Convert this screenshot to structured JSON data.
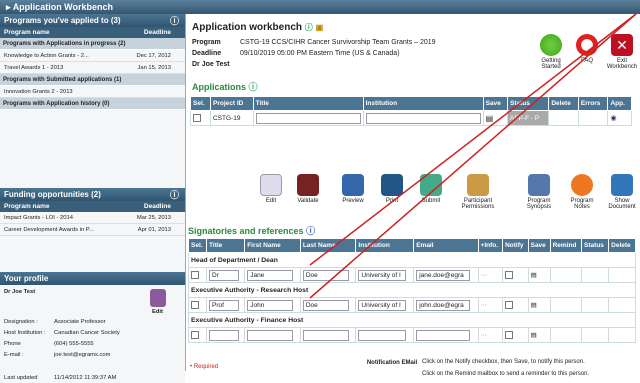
{
  "window": {
    "title": "Application Workbench"
  },
  "left": {
    "applied": {
      "title": "Programs you've applied to (3)",
      "col_name": "Program name",
      "col_deadline": "Deadline",
      "groups": [
        {
          "label": "Programs with Applications in progress (2)",
          "rows": [
            {
              "name": "Knowledge to Action Grants - 2...",
              "deadline": "Dec 17, 2012"
            },
            {
              "name": "Travel Awards 1 - 2013",
              "deadline": "Jan 15, 2013"
            }
          ]
        },
        {
          "label": "Programs with Submitted applications (1)",
          "rows": [
            {
              "name": "Innovation Grants 2 - 2013",
              "deadline": ""
            }
          ]
        },
        {
          "label": "Programs with Application history (0)",
          "rows": []
        }
      ]
    },
    "funding": {
      "title": "Funding opportunities (2)",
      "col_name": "Program name",
      "col_deadline": "Deadline",
      "rows": [
        {
          "name": "Impact Grants - LOI - 2014",
          "deadline": "Mar 25, 2013"
        },
        {
          "name": "Career Development Awards in P...",
          "deadline": "Apr 01, 2013"
        }
      ]
    },
    "profile": {
      "title": "Your profile",
      "name": "Dr Joe Test",
      "edit": "Edit",
      "fields": [
        {
          "label": "Designation :",
          "value": "Associate Professor"
        },
        {
          "label": "Host Institution :",
          "value": "Canadian Cancer Society"
        },
        {
          "label": "Phone",
          "value": "(604) 555-5555"
        },
        {
          "label": "E-mail :",
          "value": "joe.test@egrams.com"
        },
        {
          "label": "Last updated",
          "value": "11/14/2012 11:39:37 AM"
        }
      ]
    }
  },
  "header": {
    "title": "Application workbench",
    "program_label": "Program",
    "program_value": "CSTG-19 CCS/CIHR Cancer Survivorship Team Grants – 2019",
    "deadline_label": "Deadline",
    "deadline_value": "09/10/2019 05:00 PM Eastern Time (US & Canada)",
    "user": "Dr Joe Test",
    "buttons": {
      "getting_started": "Getting Started",
      "faq": "FAQ",
      "exit": "Exit Workbench"
    }
  },
  "applications": {
    "title": "Applications",
    "headers": [
      "Sel.",
      "Project ID",
      "Title",
      "Institution",
      "Save",
      "Status",
      "Delete",
      "Errors",
      "App."
    ],
    "row": {
      "project_id": "CSTG-19",
      "status": "APP-F - P"
    }
  },
  "toolbar": {
    "edit": "Edit",
    "validate": "Validate",
    "preview": "Preview",
    "print": "Print",
    "submit": "Submit",
    "participant": "Participant Permissions",
    "synopsis": "Program Synopsis",
    "notes": "Program Notes",
    "show": "Show Document"
  },
  "signatures": {
    "title": "Signatories and references",
    "headers": [
      "Sel.",
      "Title",
      "First Name",
      "Last Name",
      "Institution",
      "Email",
      "+Info.",
      "Notify",
      "Save",
      "Remind",
      "Status",
      "Delete"
    ],
    "sections": [
      {
        "label": "Head of Department / Dean",
        "title": "Dr",
        "first": "Jane",
        "last": "Doe",
        "institution": "University of I",
        "email": "jane.doe@egra"
      },
      {
        "label": "Executive Authority - Research Host",
        "title": "Prof",
        "first": "John",
        "last": "Doe",
        "institution": "University of I",
        "email": "john.doe@egra"
      },
      {
        "label": "Executive Authority - Finance Host",
        "title": "",
        "first": "",
        "last": "",
        "institution": "",
        "email": ""
      }
    ]
  },
  "footer": {
    "required": "• Required",
    "notif_label": "Notification EMail",
    "notify_text": "Click on the Notify checkbox, then Save, to notify this person.",
    "remind_text": "Click on the Remind mailbox to send a reminder to this person."
  }
}
